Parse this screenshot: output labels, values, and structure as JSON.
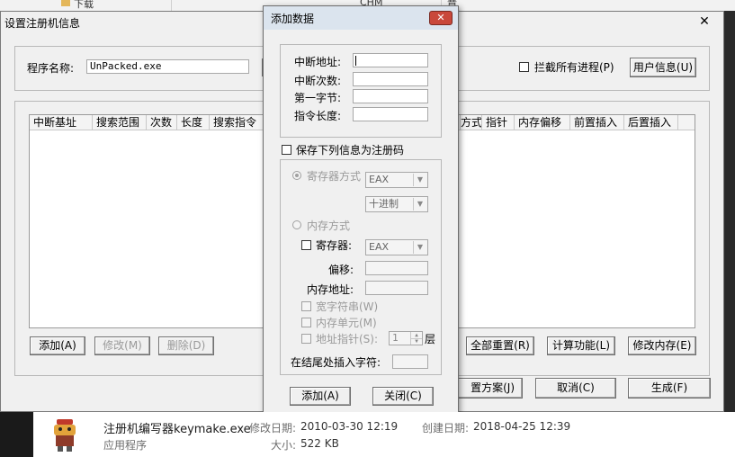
{
  "background": {
    "top_text_1": "下载",
    "top_text_2": "CHM",
    "top_text_3": "章"
  },
  "main_dialog": {
    "title": "设置注册机信息",
    "close_glyph": "✕",
    "program_name_label": "程序名称:",
    "program_name_value": "UnPacked.exe",
    "intercept_all_label": "拦截所有进程(P)",
    "user_info_button": "用户信息(U)",
    "columns_left": [
      "中断基址",
      "搜索范围",
      "次数",
      "长度",
      "搜索指令"
    ],
    "columns_right": [
      "方式",
      "指针",
      "内存偏移",
      "前置插入",
      "后置插入"
    ],
    "buttons": {
      "add": "添加(A)",
      "modify": "修改(M)",
      "delete": "删除(D)",
      "reset_all": "全部重置(R)",
      "calc": "计算功能(L)",
      "modify_memory": "修改内存(E)",
      "save_scheme": "置方案(J)",
      "cancel": "取消(C)",
      "generate": "生成(F)"
    }
  },
  "add_dialog": {
    "title": "添加数据",
    "close_glyph": "✕",
    "break_address_label": "中断地址:",
    "break_count_label": "中断次数:",
    "first_byte_label": "第一字节:",
    "instr_length_label": "指令长度:",
    "save_as_regcode_label": "保存下列信息为注册码",
    "register_mode_label": "寄存器方式",
    "register_mode_reg": "EAX",
    "register_mode_format": "十进制",
    "memory_mode_label": "内存方式",
    "register_checkbox_label": "寄存器:",
    "memory_reg": "EAX",
    "offset_label": "偏移:",
    "memory_address_label": "内存地址:",
    "wide_string_label": "宽字符串(W)",
    "memory_unit_label": "内存单元(M)",
    "address_pointer_label": "地址指针(S):",
    "pointer_level_value": "1",
    "pointer_level_suffix": "层",
    "insert_at_end_label": "在结尾处插入字符:",
    "add_button": "添加(A)",
    "close_button": "关闭(C)"
  },
  "explorer": {
    "file_name": "注册机编写器keymake.exe",
    "file_type": "应用程序",
    "modified_label": "修改日期:",
    "modified_value": "2010-03-30 12:19",
    "size_label": "大小:",
    "size_value": "522 KB",
    "created_label": "创建日期:",
    "created_value": "2018-04-25 12:39"
  }
}
